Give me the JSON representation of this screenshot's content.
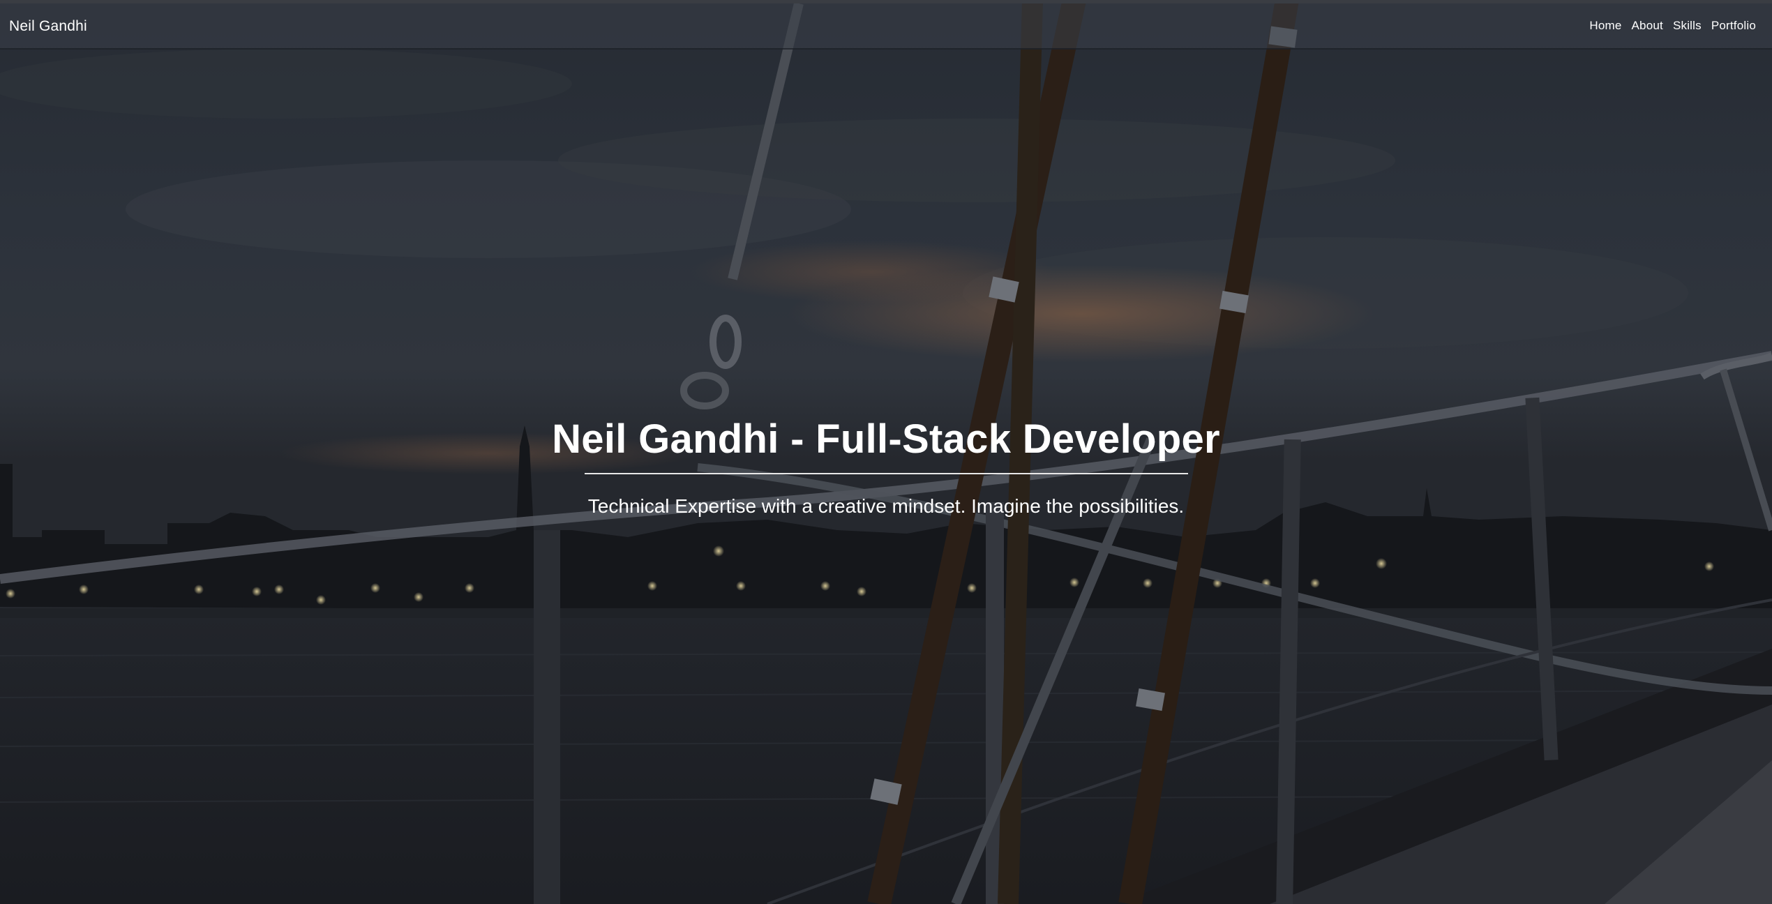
{
  "navbar": {
    "brand": "Neil Gandhi",
    "links": [
      {
        "label": "Home"
      },
      {
        "label": "About"
      },
      {
        "label": "Skills"
      },
      {
        "label": "Portfolio"
      }
    ]
  },
  "hero": {
    "title": "Neil Gandhi - Full-Stack Developer",
    "subtitle": "Technical Expertise with a creative mindset. Imagine the possibilities.",
    "background": "dark-overlay-sailboat-dusk-harbor-photo"
  },
  "colors": {
    "text": "#ffffff",
    "overlay": "#1b1f26",
    "sunset_glow": "#c9875a"
  }
}
